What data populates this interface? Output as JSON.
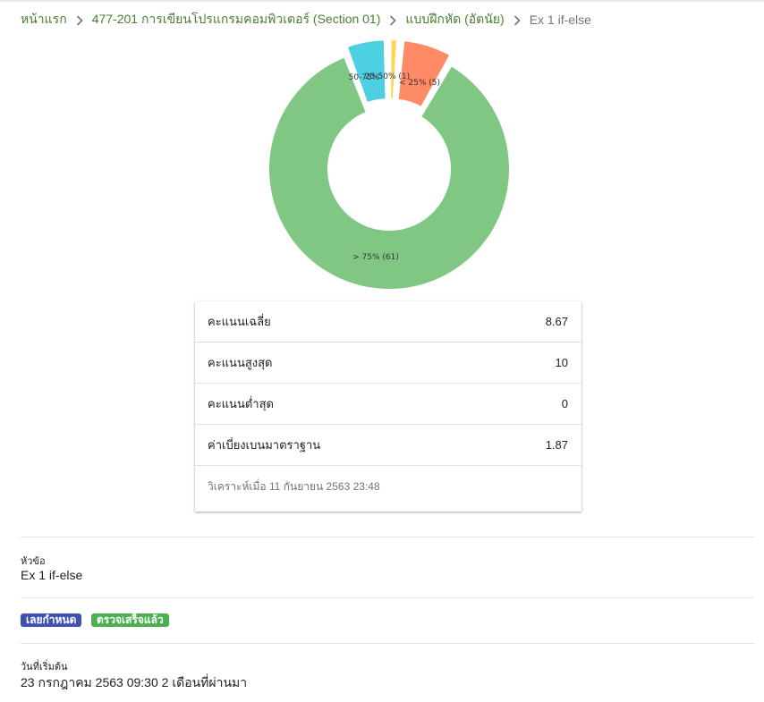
{
  "breadcrumb": {
    "home": "หน้าแรก",
    "course": "477-201 การเขียนโปรแกรมคอมพิวเตอร์ (Section 01)",
    "category": "แบบฝึกหัด (อัตนัย)",
    "current": "Ex 1 if-else"
  },
  "chart_data": {
    "type": "pie",
    "categories": [
      "> 75%",
      "< 25%",
      "25-50%",
      "50-75%"
    ],
    "values": [
      61,
      5,
      1,
      4
    ],
    "labels": [
      "> 75% (61)",
      "< 25% (5)",
      "25-50% (1)",
      "50-75%"
    ],
    "colors": [
      "#81c784",
      "#ff8a65",
      "#ffd54f",
      "#4dd0e1"
    ]
  },
  "stats": {
    "rows": [
      {
        "label": "คะแนนเฉลี่ย",
        "value": "8.67"
      },
      {
        "label": "คะแนนสูงสุด",
        "value": "10"
      },
      {
        "label": "คะแนนต่ำสุด",
        "value": "0"
      },
      {
        "label": "ค่าเบี่ยงเบนมาตราฐาน",
        "value": "1.87"
      }
    ],
    "footer": "วิเคราะห์เมื่อ 11 กันยายน 2563 23:48"
  },
  "topic": {
    "label": "หัวข้อ",
    "value": "Ex 1 if-else"
  },
  "badges": {
    "overdue": "เลยกำหนด",
    "checked": "ตรวจเสร็จแล้ว",
    "overdue_color": "#3f51b5",
    "checked_color": "#4caf50"
  },
  "start": {
    "label": "วันที่เริ่มต้น",
    "value": "23 กรกฎาคม 2563 09:30 2 เดือนที่ผ่านมา"
  }
}
